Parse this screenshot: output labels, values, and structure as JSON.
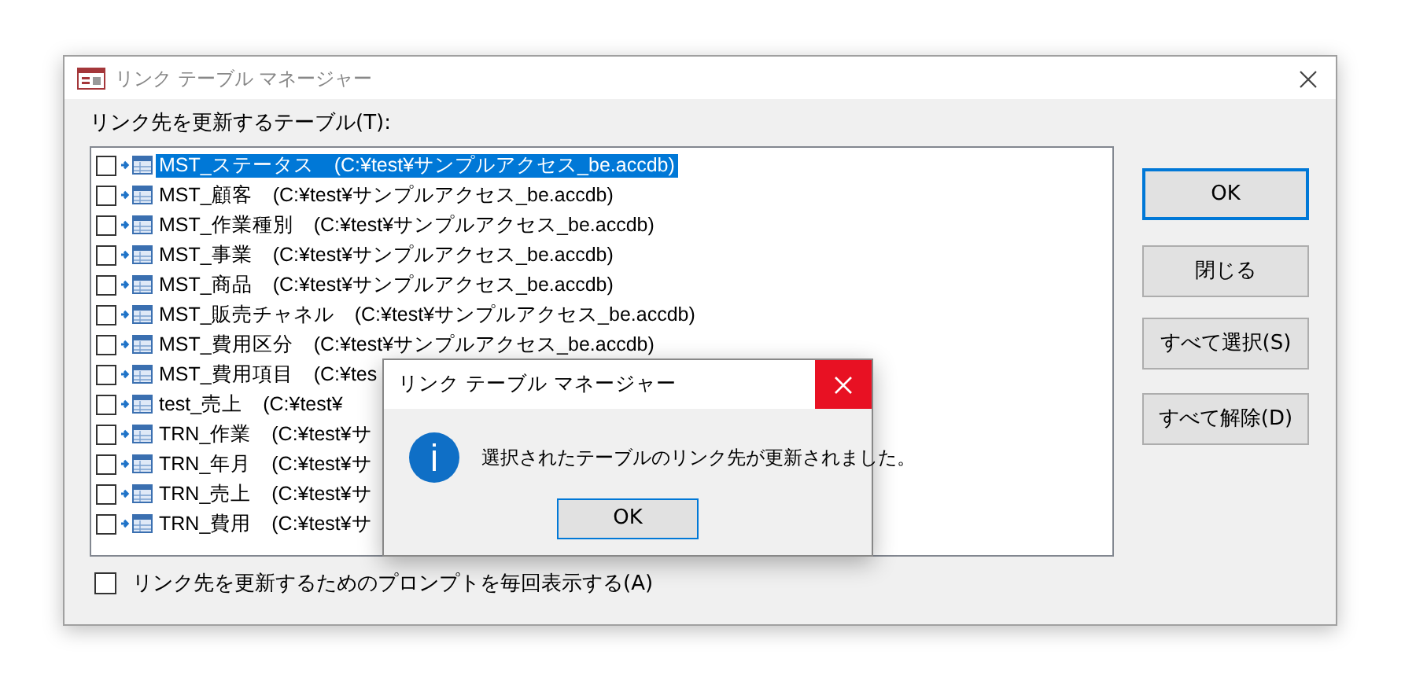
{
  "window": {
    "title": "リンク テーブル マネージャー"
  },
  "list_label": "リンク先を更新するテーブル(T):",
  "tables": [
    {
      "label": "MST_ステータス　(C:¥test¥サンプルアクセス_be.accdb)",
      "checked": false,
      "selected": true
    },
    {
      "label": "MST_顧客　(C:¥test¥サンプルアクセス_be.accdb)",
      "checked": false,
      "selected": false
    },
    {
      "label": "MST_作業種別　(C:¥test¥サンプルアクセス_be.accdb)",
      "checked": false,
      "selected": false
    },
    {
      "label": "MST_事業　(C:¥test¥サンプルアクセス_be.accdb)",
      "checked": false,
      "selected": false
    },
    {
      "label": "MST_商品　(C:¥test¥サンプルアクセス_be.accdb)",
      "checked": false,
      "selected": false
    },
    {
      "label": "MST_販売チャネル　(C:¥test¥サンプルアクセス_be.accdb)",
      "checked": false,
      "selected": false
    },
    {
      "label": "MST_費用区分　(C:¥test¥サンプルアクセス_be.accdb)",
      "checked": false,
      "selected": false
    },
    {
      "label": "MST_費用項目　(C:¥tes",
      "checked": false,
      "selected": false
    },
    {
      "label": "test_売上　(C:¥test¥",
      "checked": false,
      "selected": false
    },
    {
      "label": "TRN_作業　(C:¥test¥サ",
      "checked": false,
      "selected": false
    },
    {
      "label": "TRN_年月　(C:¥test¥サ",
      "checked": false,
      "selected": false
    },
    {
      "label": "TRN_売上　(C:¥test¥サ",
      "checked": false,
      "selected": false
    },
    {
      "label": "TRN_費用　(C:¥test¥サ",
      "checked": false,
      "selected": false
    }
  ],
  "buttons": [
    {
      "label": "OK",
      "default": true
    },
    {
      "label": "閉じる",
      "default": false
    },
    {
      "label": "すべて選択(S)",
      "default": false
    },
    {
      "label": "すべて解除(D)",
      "default": false
    }
  ],
  "prompt_option": {
    "label": "リンク先を更新するためのプロンプトを毎回表示する(A)",
    "checked": false
  },
  "message_box": {
    "title": "リンク テーブル マネージャー",
    "message": "選択されたテーブルのリンク先が更新されました。",
    "button": "OK"
  }
}
